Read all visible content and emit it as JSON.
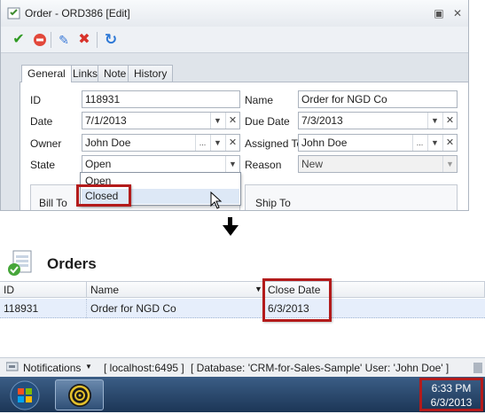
{
  "edit_window": {
    "title": "Order - ORD386 [Edit]",
    "tabs": [
      {
        "label": "General",
        "active": true
      },
      {
        "label": "Links"
      },
      {
        "label": "Note"
      },
      {
        "label": "History"
      }
    ],
    "fields": {
      "id": {
        "label": "ID",
        "value": "118931"
      },
      "name": {
        "label": "Name",
        "value": "Order for NGD Co"
      },
      "date": {
        "label": "Date",
        "value": "7/1/2013"
      },
      "due_date": {
        "label": "Due Date",
        "value": "7/3/2013"
      },
      "owner": {
        "label": "Owner",
        "value": "John Doe"
      },
      "assigned_to": {
        "label": "Assigned To",
        "value": "John Doe"
      },
      "state": {
        "label": "State",
        "value": "Open"
      },
      "reason": {
        "label": "Reason",
        "value": "New"
      }
    },
    "state_dropdown_options": [
      "Open",
      "Closed"
    ],
    "groups": {
      "bill_to": "Bill To",
      "ship_to": "Ship To"
    }
  },
  "orders_list": {
    "title": "Orders",
    "columns": [
      "ID",
      "Name",
      "Close Date"
    ],
    "rows": [
      {
        "id": "118931",
        "name": "Order for NGD Co",
        "close_date": "6/3/2013"
      }
    ]
  },
  "status_bar": {
    "notifications": "Notifications",
    "server": "[ localhost:6495 ]",
    "database": "[ Database: 'CRM-for-Sales-Sample'  User: 'John Doe' ]"
  },
  "taskbar": {
    "time": "6:33 PM",
    "date": "6/3/2013"
  },
  "colors": {
    "highlight_box": "#b31b1b",
    "selected_row": "#e6eefb",
    "taskbar": "#1c3656"
  }
}
